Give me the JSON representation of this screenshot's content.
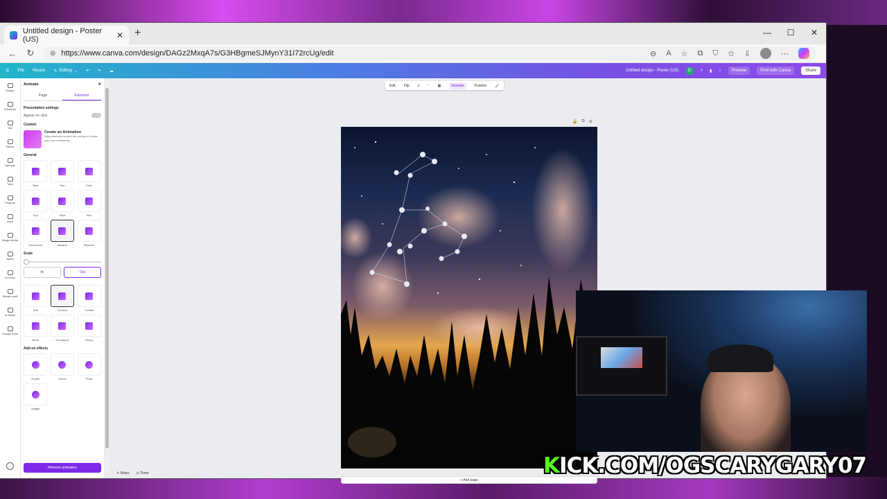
{
  "browser": {
    "tab_title": "Untitled design - Poster (US)",
    "url": "https://www.canva.com/design/DAGz2MxqA7s/G3HBgmeSJMynY31I72rcUg/edit"
  },
  "canva_header": {
    "file": "File",
    "resize": "Resize",
    "editing": "Editing",
    "design_title": "Untitled design - Poster (US)",
    "avatar": "G",
    "preview": "Preview",
    "print": "Print with Canva",
    "share": "Share"
  },
  "rail": [
    "Design",
    "Elements",
    "Text",
    "Brand",
    "Uploads",
    "Tools",
    "Projects",
    "Apps",
    "Magic Media",
    "Audio",
    "AI Voice",
    "Stream stuff",
    "AI Music",
    "Google Drive"
  ],
  "panel": {
    "title": "Animate",
    "tab_page": "Page",
    "tab_element": "Element",
    "presentation_settings": "Presentation settings",
    "appear_on_click": "Appear on click",
    "custom": "Custom",
    "create_title": "Create an Animation",
    "create_desc": "Drag elements around the canvas to create your own animations",
    "general": "General",
    "general_items": [
      "Rise",
      "Pan",
      "Fade",
      "Pop",
      "Wipe",
      "Blur",
      "Succession",
      "Breathe",
      "Baseline"
    ],
    "scale": "Scale",
    "in": "In",
    "out": "Out",
    "more_items": [
      "Drift",
      "Tectonic",
      "Tumble",
      "Neon",
      "Scrapbook",
      "Stomp"
    ],
    "addon": "Add-on effects",
    "addon_items": [
      "Rotate",
      "Flicker",
      "Pulse",
      "Wiggle"
    ],
    "remove": "Remove animation"
  },
  "toolbar": {
    "edit": "Edit",
    "flip": "Flip",
    "animate": "Animate",
    "position": "Position"
  },
  "add_page": "+ Add page",
  "footer": {
    "notes": "Notes",
    "timer": "Timer"
  },
  "overlay": {
    "kick_k": "K",
    "kick_rest": "ICK.COM/OGSCARYGARY07"
  }
}
